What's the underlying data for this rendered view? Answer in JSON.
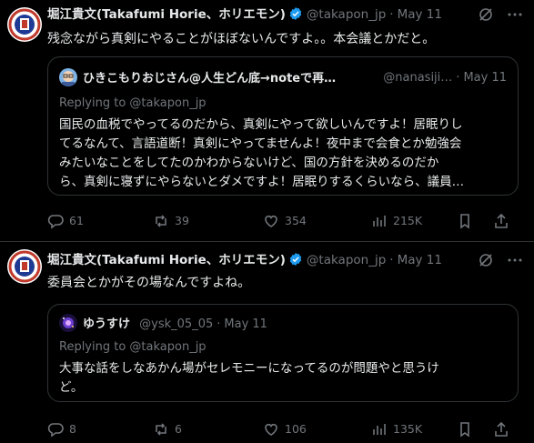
{
  "colors": {
    "background": "#000000",
    "text": "#e7e9ea",
    "muted": "#71767b",
    "border": "#2f3336",
    "verified": "#1d9bf0"
  },
  "posts": [
    {
      "author_name": "堀江貴文(Takafumi Horie、ホリエモン)",
      "handle": "@takapon_jp",
      "date": "May 11",
      "verified": true,
      "text": "残念ながら真剣にやることがほぼないんですよ。。本会議とかだと。",
      "quote": {
        "author_name": "ひきこもりおじさん@人生どん底→noteで再…",
        "handle": "@nanasiji…",
        "date": "May 11",
        "replying_to": "Replying to @takapon_jp",
        "lines": [
          "国民の血税でやってるのだから、真剣にやって欲しいんですよ！居眠りし",
          "てるなんて、言語道断！真剣にやってませんよ！夜中まで会食とか勉強会",
          "みたいなことをしてたのかわからないけど、国の方針を決めるのだか",
          "ら、真剣に寝ずにやらないとダメですよ！居眠りするくらいなら、議員…"
        ]
      },
      "stats": {
        "replies": "61",
        "reposts": "39",
        "likes": "354",
        "views": "215K"
      }
    },
    {
      "author_name": "堀江貴文(Takafumi Horie、ホリエモン)",
      "handle": "@takapon_jp",
      "date": "May 11",
      "verified": true,
      "text": "委員会とかがその場なんですよね。",
      "quote": {
        "author_name": "ゆうすけ",
        "handle": "@ysk_05_05",
        "date": "May 11",
        "replying_to": "Replying to @takapon_jp",
        "lines": [
          "大事な話をしなあかん場がセレモニーになってるのが問題やと思うけ",
          "ど。"
        ]
      },
      "stats": {
        "replies": "8",
        "reposts": "6",
        "likes": "106",
        "views": "135K"
      }
    }
  ],
  "icons": [
    "grok-icon",
    "more-icon",
    "reply-icon",
    "repost-icon",
    "like-icon",
    "views-icon",
    "bookmark-icon",
    "share-icon"
  ],
  "separator": "·"
}
